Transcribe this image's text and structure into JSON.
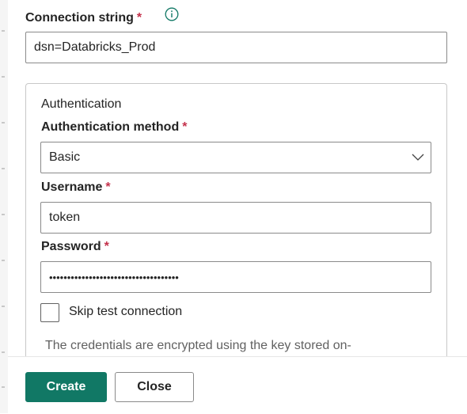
{
  "connection_string": {
    "label": "Connection string",
    "required_mark": "*",
    "value": "dsn=Databricks_Prod"
  },
  "authentication": {
    "title": "Authentication",
    "method": {
      "label": "Authentication method",
      "required_mark": "*",
      "selected": "Basic"
    },
    "username": {
      "label": "Username",
      "required_mark": "*",
      "value": "token"
    },
    "password": {
      "label": "Password",
      "required_mark": "*",
      "masked_value": "••••••••••••••••••••••••••••••••••••"
    },
    "skip_test": {
      "label": "Skip test connection",
      "checked": false
    },
    "description": "The credentials are encrypted using the key stored on-"
  },
  "footer": {
    "create_label": "Create",
    "close_label": "Close"
  },
  "colors": {
    "primary": "#117865",
    "required": "#c4314b",
    "border": "#8a8a8a"
  },
  "icons": {
    "info": "info-icon",
    "dropdown": "chevron-down-icon"
  }
}
